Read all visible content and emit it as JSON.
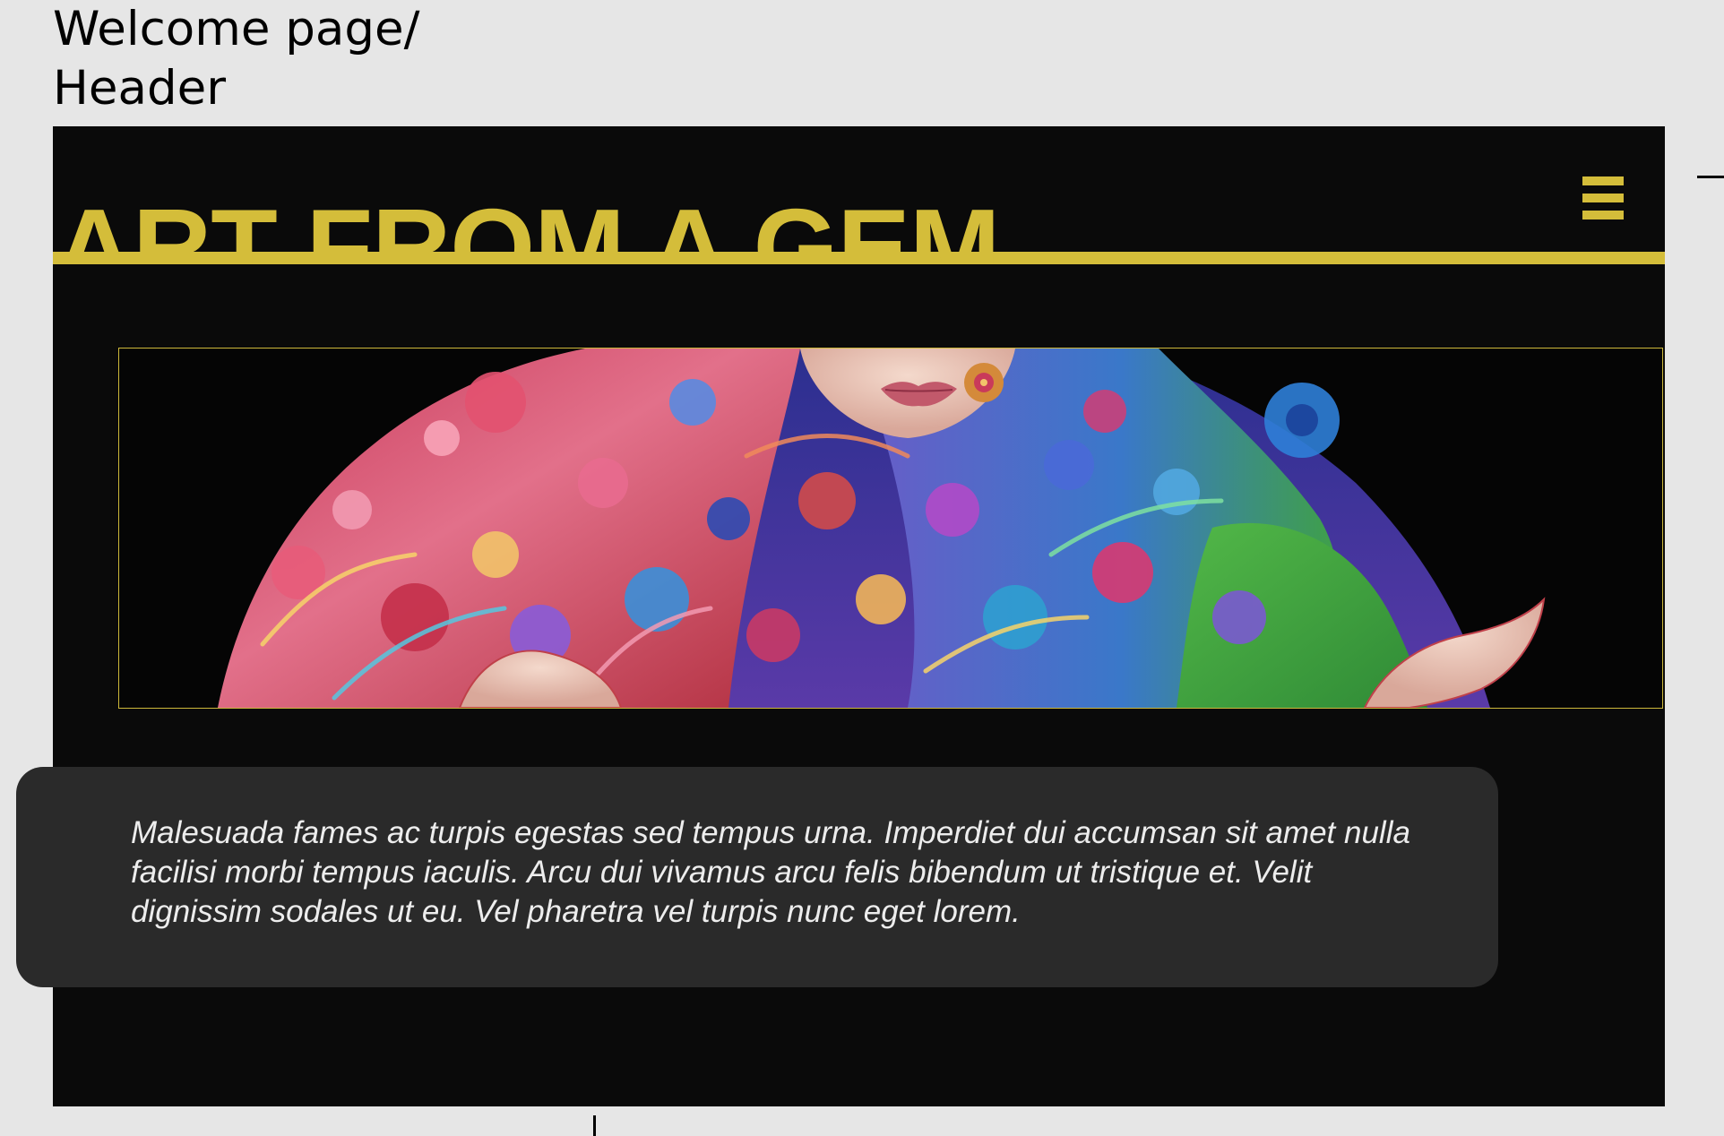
{
  "frame": {
    "caption": "Welcome page/\nHeader"
  },
  "header": {
    "brand_title": "ART FROM A GEM",
    "menu_icon": "hamburger-menu-icon"
  },
  "hero": {
    "image_subject": "painting of a figure wrapped in colorful flowers and patterns"
  },
  "intro": {
    "text": "Malesuada fames ac turpis egestas sed tempus urna. Imperdiet dui accumsan sit amet nulla facilisi morbi tempus iaculis. Arcu dui vivamus arcu felis bibendum ut tristique et. Velit dignissim sodales ut eu. Vel pharetra vel turpis nunc eget lorem."
  },
  "colors": {
    "page_background": "#0a0a0a",
    "accent_yellow": "#d4bd3a",
    "card_background": "#2a2a2a",
    "canvas_background": "#e6e6e6"
  }
}
